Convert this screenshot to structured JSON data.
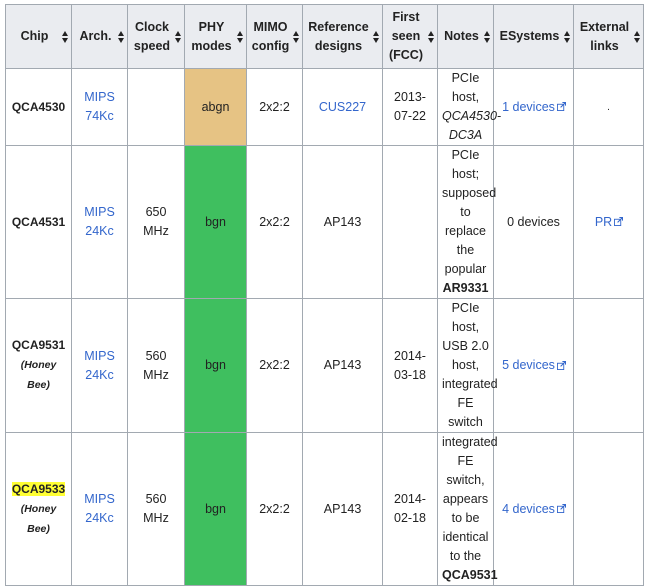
{
  "headers": {
    "chip": "Chip",
    "arch": "Arch.",
    "clock_1": "Clock",
    "clock_2": "speed",
    "phy_1": "PHY",
    "phy_2": "modes",
    "mimo_1": "MIMO",
    "mimo_2": "config",
    "ref_1": "Reference",
    "ref_2": "designs",
    "first_1": "First",
    "first_2": "seen",
    "first_3": "(FCC)",
    "notes": "Notes",
    "esystems": "ESystems",
    "ext_1": "External",
    "ext_2": "links"
  },
  "colors": {
    "phy_abgn": "#e6c384",
    "phy_bgn": "#3fbf5f",
    "link": "#3366cc",
    "header_bg": "#eaecf0",
    "highlight": "#ffff33"
  },
  "icons": {
    "sort": "sort-arrows-icon",
    "external": "external-link-icon"
  },
  "rows": [
    {
      "chip": "QCA4530",
      "subname": "",
      "arch_1": "MIPS",
      "arch_2": "74Kc",
      "clock_1": "",
      "clock_2": "",
      "phy": "abgn",
      "mimo": "2x2:2",
      "ref": "CUS227",
      "first_1": "2013-",
      "first_2": "07-22",
      "notes": [
        "PCIe host,",
        "QCA4530-",
        "DC3A"
      ],
      "esystems": "1 devices",
      "ext": "."
    },
    {
      "chip": "QCA4531",
      "subname": "",
      "arch_1": "MIPS",
      "arch_2": "24Kc",
      "clock_1": "650",
      "clock_2": "MHz",
      "phy": "bgn",
      "mimo": "2x2:2",
      "ref": "AP143",
      "first_1": "",
      "first_2": "",
      "notes": [
        "PCIe host;",
        "supposed",
        "to",
        "replace",
        "the",
        "popular",
        "AR9331"
      ],
      "esystems": "0 devices",
      "ext": "PR"
    },
    {
      "chip": "QCA9531",
      "subname": "(Honey Bee)",
      "arch_1": "MIPS",
      "arch_2": "24Kc",
      "clock_1": "560",
      "clock_2": "MHz",
      "phy": "bgn",
      "mimo": "2x2:2",
      "ref": "AP143",
      "first_1": "2014-",
      "first_2": "03-18",
      "notes": [
        "PCIe host,",
        "USB 2.0",
        "host,",
        "integrated",
        "FE switch"
      ],
      "esystems": "5 devices",
      "ext": ""
    },
    {
      "chip": "QCA9533",
      "subname": "(Honey Bee)",
      "arch_1": "MIPS",
      "arch_2": "24Kc",
      "clock_1": "560",
      "clock_2": "MHz",
      "phy": "bgn",
      "mimo": "2x2:2",
      "ref": "AP143",
      "first_1": "2014-",
      "first_2": "02-18",
      "notes": [
        "integrated",
        "FE switch,",
        "appears",
        "to be",
        "identical",
        "to the",
        "QCA9531"
      ],
      "esystems": "4 devices",
      "ext": ""
    }
  ]
}
